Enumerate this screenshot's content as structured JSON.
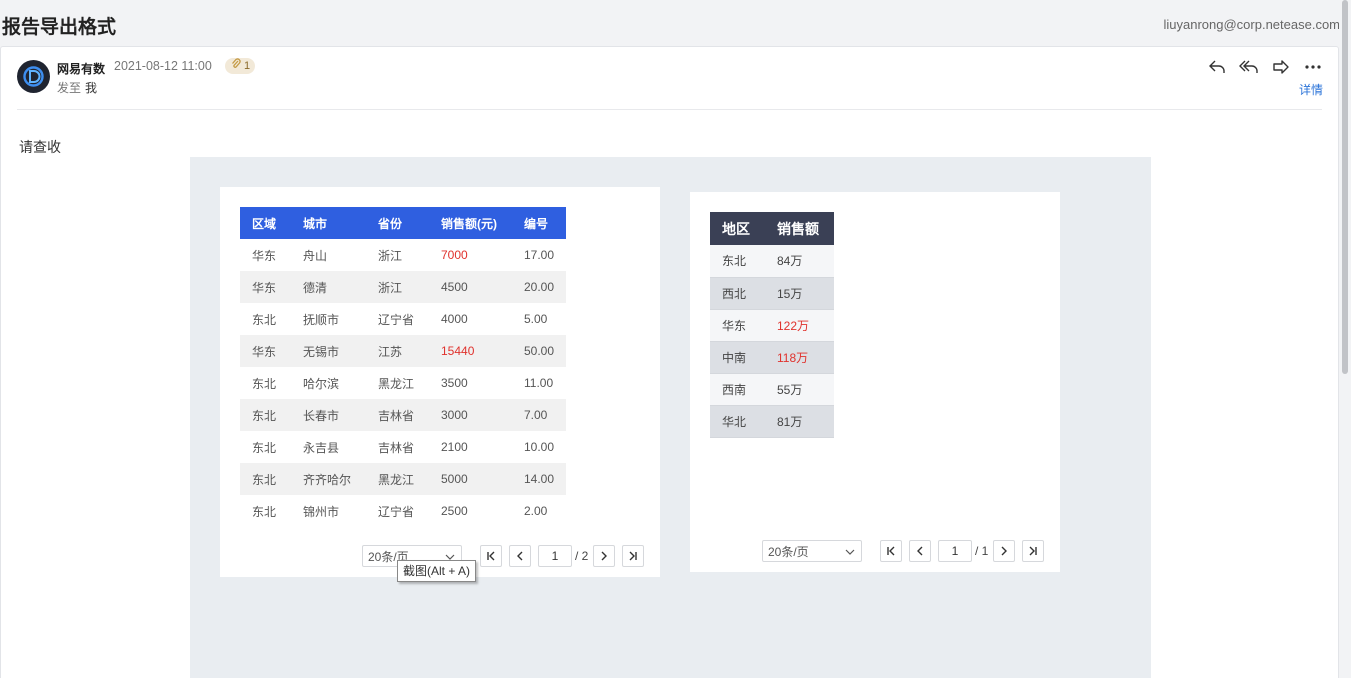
{
  "subject": "报告导出格式",
  "account": "liuyanrong@corp.netease.com",
  "sender": "网易有数",
  "date": "2021-08-12 11:00",
  "attachment_count": "1",
  "to_label": "发至",
  "to_value": "我",
  "detail_link": "详情",
  "greeting": "请查收",
  "actions": [
    "reply-icon",
    "reply-all-icon",
    "forward-icon",
    "more-icon"
  ],
  "table1": {
    "headers": [
      "区域",
      "城市",
      "省份",
      "销售额(元)",
      "编号"
    ],
    "rows": [
      [
        "华东",
        "舟山",
        "浙江",
        "7000",
        "17.00"
      ],
      [
        "华东",
        "德清",
        "浙江",
        "4500",
        "20.00"
      ],
      [
        "东北",
        "抚顺市",
        "辽宁省",
        "4000",
        "5.00"
      ],
      [
        "华东",
        "无锡市",
        "江苏",
        "15440",
        "50.00"
      ],
      [
        "东北",
        "哈尔滨",
        "黑龙江",
        "3500",
        "11.00"
      ],
      [
        "东北",
        "长春市",
        "吉林省",
        "3000",
        "7.00"
      ],
      [
        "东北",
        "永吉县",
        "吉林省",
        "2100",
        "10.00"
      ],
      [
        "东北",
        "齐齐哈尔",
        "黑龙江",
        "5000",
        "14.00"
      ],
      [
        "东北",
        "锦州市",
        "辽宁省",
        "2500",
        "2.00"
      ]
    ],
    "highlight_rows": [
      0,
      3
    ],
    "highlight_color": "#e0322d",
    "header_color": "#2f5fe0",
    "pager": {
      "page_size": "20条/页",
      "current": "1",
      "total": "/ 2"
    }
  },
  "table2": {
    "headers": [
      "地区",
      "销售额"
    ],
    "rows": [
      [
        "东北",
        "84万"
      ],
      [
        "西北",
        "15万"
      ],
      [
        "华东",
        "122万"
      ],
      [
        "中南",
        "118万"
      ],
      [
        "西南",
        "55万"
      ],
      [
        "华北",
        "81万"
      ]
    ],
    "highlight_rows": [
      2,
      3
    ],
    "highlight_color": "#e0322d",
    "header_color": "#3a4055",
    "pager": {
      "page_size": "20条/页",
      "current": "1",
      "total": "/ 1"
    }
  },
  "tooltip": "截图(Alt + A)"
}
